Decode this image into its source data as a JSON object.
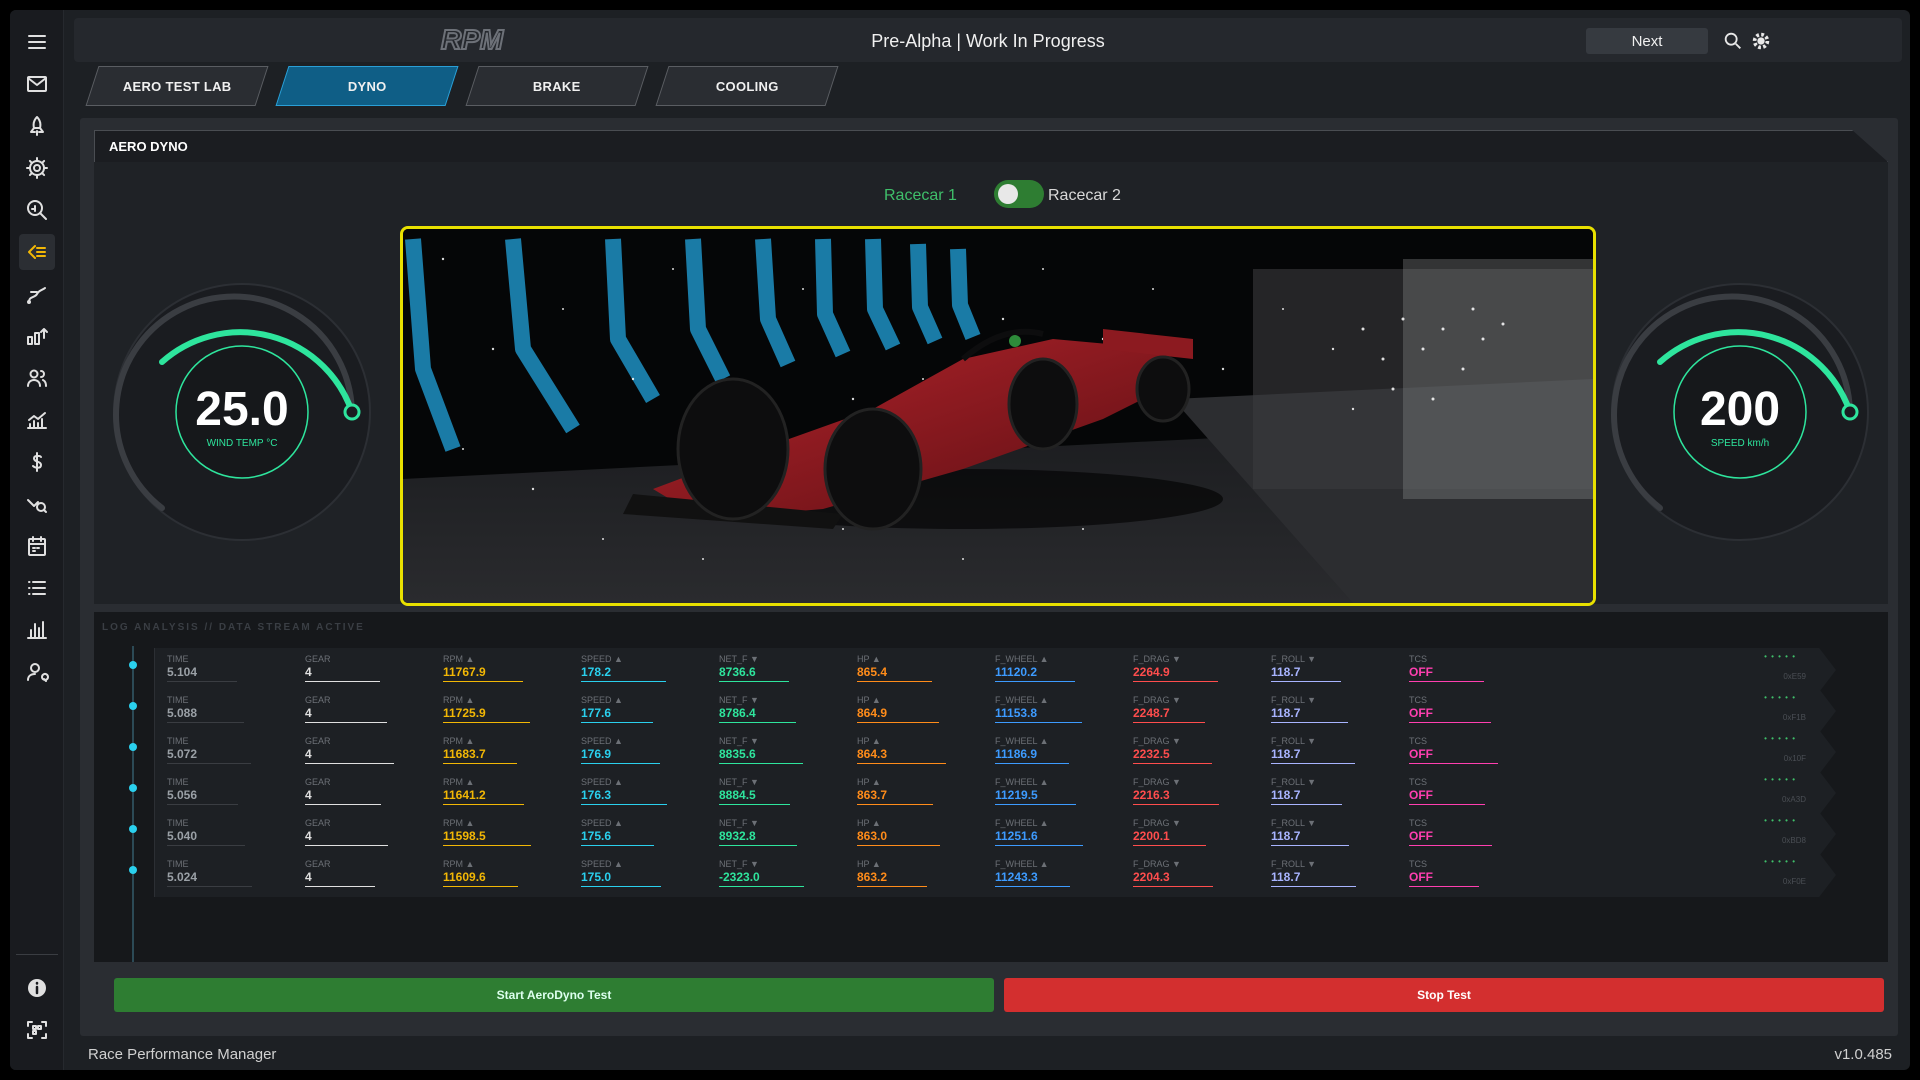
{
  "app": {
    "logo_text": "RPM",
    "title": "Pre-Alpha | Work In Progress",
    "next_label": "Next",
    "footer_left": "Race Performance Manager",
    "version": "v1.0.485"
  },
  "sidebar": {
    "items": [
      {
        "name": "menu-icon"
      },
      {
        "name": "mail-icon"
      },
      {
        "name": "rocket-icon"
      },
      {
        "name": "gear-icon"
      },
      {
        "name": "search-analytics-icon"
      },
      {
        "name": "dyno-icon",
        "active": true
      },
      {
        "name": "track-curve-icon"
      },
      {
        "name": "upgrade-chart-icon"
      },
      {
        "name": "team-icon"
      },
      {
        "name": "stats-growth-icon"
      },
      {
        "name": "dollar-icon"
      },
      {
        "name": "trend-search-icon"
      },
      {
        "name": "calendar-icon"
      },
      {
        "name": "list-icon"
      },
      {
        "name": "bar-chart-icon"
      },
      {
        "name": "person-search-icon"
      }
    ],
    "bottom": [
      {
        "name": "info-icon"
      },
      {
        "name": "scan-icon"
      }
    ]
  },
  "tabs": [
    {
      "label": "AERO TEST LAB",
      "active": false
    },
    {
      "label": "DYNO",
      "active": true
    },
    {
      "label": "BRAKE",
      "active": false
    },
    {
      "label": "COOLING",
      "active": false
    }
  ],
  "section": {
    "title": "AERO DYNO",
    "toggle": {
      "left_label": "Racecar 1",
      "right_label": "Racecar 2"
    }
  },
  "gauges": {
    "left": {
      "value": "25.0",
      "label": "WIND TEMP °C",
      "fraction": 0.55
    },
    "right": {
      "value": "200",
      "label": "SPEED km/h",
      "fraction": 0.55
    }
  },
  "log": {
    "title": "LOG ANALYSIS // DATA STREAM ACTIVE",
    "headers": [
      "TIME",
      "GEAR",
      "RPM ▲",
      "SPEED ▲",
      "NET_F ▼",
      "HP ▲",
      "F_WHEEL ▲",
      "F_DRAG ▼",
      "F_ROLL ▼",
      "TCS"
    ],
    "colors": [
      "#9aa0a6",
      "#e0e0e0",
      "#f2b705",
      "#2ad0ee",
      "#2ee59d",
      "#ff8c1a",
      "#3d9bff",
      "#ff4d4d",
      "#a8b4ff",
      "#ff3fb0"
    ],
    "rows": [
      {
        "cells": [
          "5.104",
          "4",
          "11767.9",
          "178.2",
          "8736.6",
          "865.4",
          "11120.2",
          "2264.9",
          "118.7",
          "OFF"
        ],
        "hex": "0xE59"
      },
      {
        "cells": [
          "5.088",
          "4",
          "11725.9",
          "177.6",
          "8786.4",
          "864.9",
          "11153.8",
          "2248.7",
          "118.7",
          "OFF"
        ],
        "hex": "0xF1B"
      },
      {
        "cells": [
          "5.072",
          "4",
          "11683.7",
          "176.9",
          "8835.6",
          "864.3",
          "11186.9",
          "2232.5",
          "118.7",
          "OFF"
        ],
        "hex": "0x10F"
      },
      {
        "cells": [
          "5.056",
          "4",
          "11641.2",
          "176.3",
          "8884.5",
          "863.7",
          "11219.5",
          "2216.3",
          "118.7",
          "OFF"
        ],
        "hex": "0xA3D"
      },
      {
        "cells": [
          "5.040",
          "4",
          "11598.5",
          "175.6",
          "8932.8",
          "863.0",
          "11251.6",
          "2200.1",
          "118.7",
          "OFF"
        ],
        "hex": "0xBD8"
      },
      {
        "cells": [
          "5.024",
          "4",
          "11609.6",
          "175.0",
          "-2323.0",
          "863.2",
          "11243.3",
          "2204.3",
          "118.7",
          "OFF"
        ],
        "hex": "0xF0E"
      }
    ]
  },
  "buttons": {
    "start": "Start AeroDyno Test",
    "stop": "Stop Test"
  }
}
